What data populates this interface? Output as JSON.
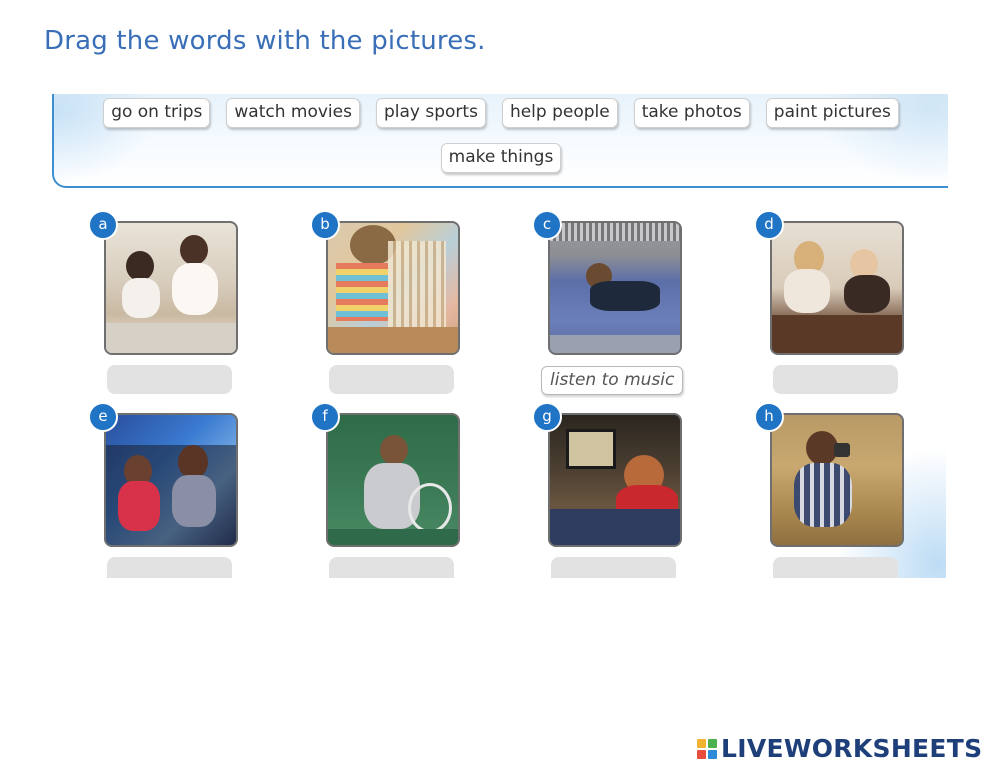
{
  "instruction": "Drag the words with the pictures.",
  "word_bank": {
    "row1": [
      "go on trips",
      "watch movies",
      "play sports",
      "help people",
      "take photos",
      "paint pictures"
    ],
    "row2": [
      "make things"
    ]
  },
  "cards": [
    {
      "letter": "a",
      "answer": ""
    },
    {
      "letter": "b",
      "answer": ""
    },
    {
      "letter": "c",
      "answer": "listen to music"
    },
    {
      "letter": "d",
      "answer": ""
    },
    {
      "letter": "e",
      "answer": ""
    },
    {
      "letter": "f",
      "answer": ""
    },
    {
      "letter": "g",
      "answer": ""
    },
    {
      "letter": "h",
      "answer": ""
    }
  ],
  "logo": {
    "text": "LIVEWORKSHEETS",
    "mark_letters": [
      "L",
      "I",
      "V",
      "E"
    ],
    "colors": [
      "#f2b233",
      "#4caf50",
      "#e94e3c",
      "#2e8bd8"
    ]
  }
}
